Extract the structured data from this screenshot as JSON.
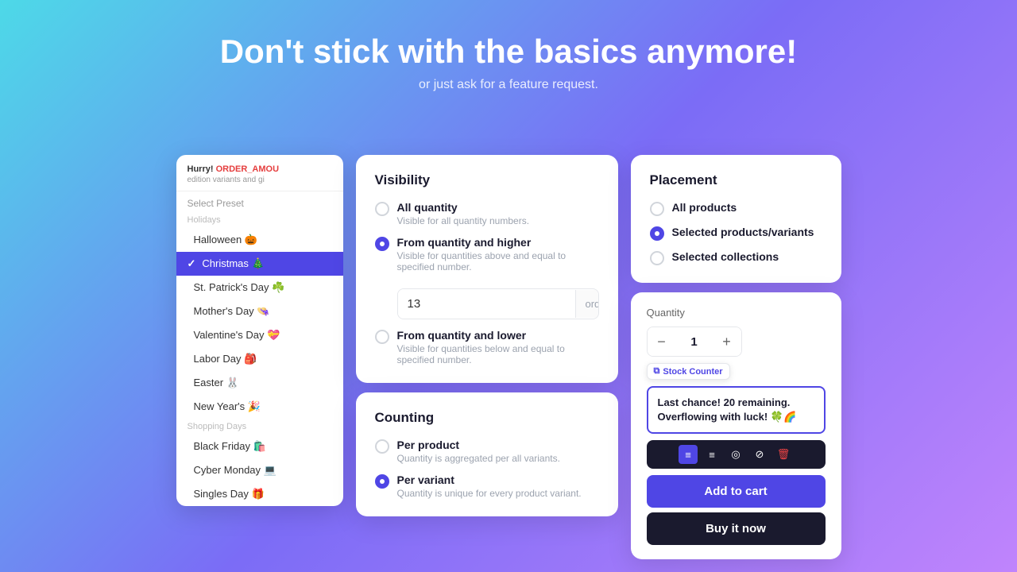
{
  "header": {
    "title": "Don't stick with the basics anymore!",
    "subtitle": "or just ask for a feature request."
  },
  "left_panel": {
    "hurry_prefix": "Hurry! ",
    "hurry_highlight": "ORDER_AMOU",
    "hurry_suffix": "",
    "subtitle": "edition variants and gi",
    "select_preset": "Select Preset",
    "holidays_label": "Holidays",
    "shopping_days_label": "Shopping Days",
    "holiday_items": [
      {
        "label": "Halloween 🎃",
        "selected": false
      },
      {
        "label": "Christmas 🎄",
        "selected": true
      },
      {
        "label": "St. Patrick's Day ☘️",
        "selected": false
      },
      {
        "label": "Mother's Day 👒",
        "selected": false
      },
      {
        "label": "Valentine's Day 💝",
        "selected": false
      },
      {
        "label": "Labor Day 🎒",
        "selected": false
      },
      {
        "label": "Easter 🐰",
        "selected": false
      },
      {
        "label": "New Year's 🎉",
        "selected": false
      }
    ],
    "shopping_items": [
      {
        "label": "Black Friday 🛍️",
        "selected": false
      },
      {
        "label": "Cyber Monday 💻",
        "selected": false
      },
      {
        "label": "Singles Day 🎁",
        "selected": false
      }
    ]
  },
  "visibility_card": {
    "title": "Visibility",
    "options": [
      {
        "label": "All quantity",
        "desc": "Visible for all quantity numbers.",
        "checked": false
      },
      {
        "label": "From quantity and higher",
        "desc": "Visible for quantities above and equal to specified number.",
        "checked": true
      },
      {
        "label": "From quantity and lower",
        "desc": "Visible for quantities below and equal to specified number.",
        "checked": false
      }
    ],
    "input_value": "13",
    "input_unit": "orders"
  },
  "counting_card": {
    "title": "Counting",
    "options": [
      {
        "label": "Per product",
        "desc": "Quantity is aggregated per all variants.",
        "checked": false
      },
      {
        "label": "Per variant",
        "desc": "Quantity is unique for every product variant.",
        "checked": true
      }
    ]
  },
  "placement_card": {
    "title": "Placement",
    "options": [
      {
        "label": "All products",
        "checked": false
      },
      {
        "label": "Selected products/variants",
        "checked": true
      },
      {
        "label": "Selected collections",
        "checked": false
      }
    ]
  },
  "quantity_card": {
    "label": "Quantity",
    "value": "1",
    "badge": "Stock Counter",
    "message_line1": "Last chance! 20 remaining.",
    "message_line2": "Overflowing with luck! 🍀🌈",
    "add_to_cart": "Add to cart",
    "buy_now": "Buy it now"
  }
}
